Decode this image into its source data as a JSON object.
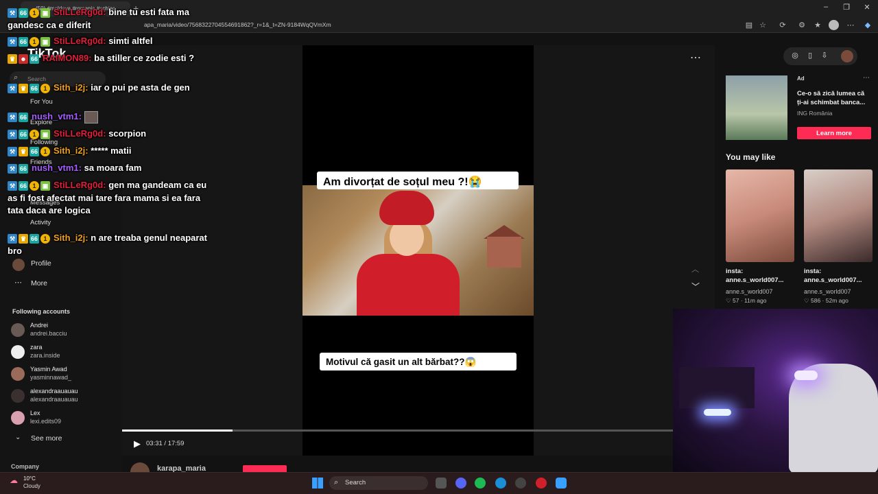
{
  "browser": {
    "tab_title": "(50) #moldova #romania #schiac",
    "url": "apa_maria/video/7568322704554691862?_r=1&_t=ZN-9184WqQVmXm"
  },
  "sidebar": {
    "logo": "TikTok",
    "search_placeholder": "Search",
    "nav": [
      {
        "label": "For You"
      },
      {
        "label": "Explore"
      },
      {
        "label": "Following"
      },
      {
        "label": "Friends"
      },
      {
        "label": "Messages"
      },
      {
        "label": "Activity"
      },
      {
        "label": "Profile"
      },
      {
        "label": "More"
      }
    ],
    "following_heading": "Following accounts",
    "following_accounts": [
      {
        "name": "Andrei",
        "username": "andrei.bacciu"
      },
      {
        "name": "zara",
        "username": "zara.inside"
      },
      {
        "name": "Yasmin Awad",
        "username": "yasminnawad_"
      },
      {
        "name": "alexandraauauau",
        "username": "alexandraauauau"
      },
      {
        "name": "Lex",
        "username": "lexi.edits09"
      }
    ],
    "see_more": "See more",
    "company": "Company"
  },
  "video": {
    "caption_top": "Am divorțat de soțul meu ?!😭",
    "caption_bottom": "Motivul că gasit un alt bărbat??😱",
    "progress": 0.2,
    "time": "03:31 / 17:59",
    "author": "karapa_maria"
  },
  "right_panel": {
    "ad": {
      "label": "Ad",
      "title": "Ce-o să zică lumea că ți-ai schimbat banca...",
      "brand": "ING România",
      "cta": "Learn more"
    },
    "you_may_like": "You may like",
    "suggestions": [
      {
        "title": "insta: anne.s_world007...",
        "username": "anne.s_world007",
        "likes": "57",
        "age": "11m ago"
      },
      {
        "title": "insta: anne.s_world007...",
        "username": "anne.s_world007",
        "likes": "586",
        "age": "52m ago"
      }
    ]
  },
  "chat": [
    {
      "user": "StiLLeRg0d:",
      "color": "red",
      "text": "bine tu esti fata ma gandesc ca e diferit"
    },
    {
      "user": "StiLLeRg0d:",
      "color": "red",
      "text": "simti altfel"
    },
    {
      "user": "RAIMON89:",
      "color": "red",
      "text": "ba stiller ce zodie esti ?"
    },
    {
      "user": "Sith_i2j:",
      "color": "gold",
      "text": "iar o pui pe asta de gen"
    },
    {
      "user": "nush_vtm1:",
      "color": "purple",
      "text": ""
    },
    {
      "user": "StiLLeRg0d:",
      "color": "red",
      "text": "scorpion"
    },
    {
      "user": "Sith_i2j:",
      "color": "gold",
      "text": "***** matii"
    },
    {
      "user": "nush_vtm1:",
      "color": "purple",
      "text": "sa moara fam"
    },
    {
      "user": "StiLLeRg0d:",
      "color": "red",
      "text": "gen ma gandeam ca eu as fi fost afectat mai tare fara mama si ea fara tata daca are logica"
    },
    {
      "user": "Sith_i2j:",
      "color": "gold",
      "text": "n are treaba genul neaparat bro"
    }
  ],
  "taskbar": {
    "temperature": "10°C",
    "weather": "Cloudy",
    "search": "Search"
  },
  "colors": {
    "tiktok_red": "#fe2c55",
    "chat_red": "#e0203a",
    "chat_gold": "#f0a020",
    "chat_purple": "#a65cff"
  }
}
